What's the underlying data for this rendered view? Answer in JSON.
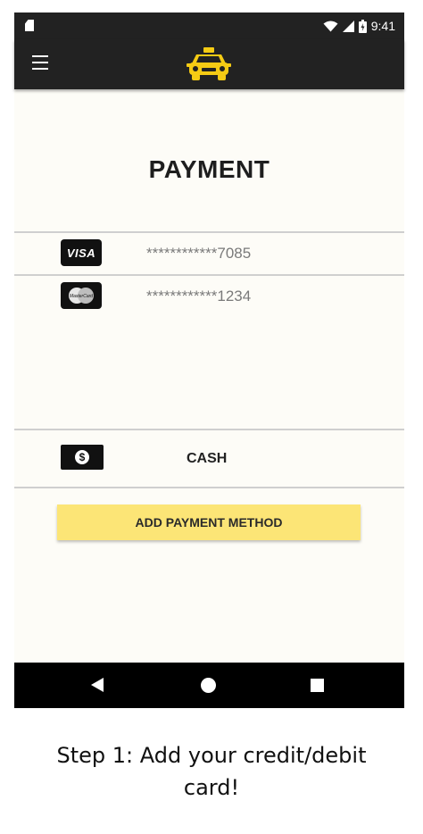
{
  "status_bar": {
    "time": "9:41",
    "icons": [
      "sim-card-icon",
      "wifi-icon",
      "signal-icon",
      "battery-icon"
    ]
  },
  "app_bar": {
    "menu_icon": "hamburger-menu-icon",
    "logo_icon": "taxi-icon",
    "logo_color": "#F5CB14"
  },
  "page": {
    "title": "PAYMENT"
  },
  "payment_methods": [
    {
      "brand": "VISA",
      "icon": "visa-card-icon",
      "number": "************7085"
    },
    {
      "brand": "MasterCard",
      "icon": "mastercard-icon",
      "number": "************1234"
    }
  ],
  "cash": {
    "icon": "dollar-bill-icon",
    "label": "CASH"
  },
  "add_button": {
    "label": "ADD PAYMENT METHOD",
    "color": "#FCE576"
  },
  "nav_bar": {
    "icons": [
      "back-triangle-icon",
      "home-circle-icon",
      "recents-square-icon"
    ]
  },
  "caption": {
    "line1": "Step 1: Add your credit/debit",
    "line2": "card!"
  }
}
